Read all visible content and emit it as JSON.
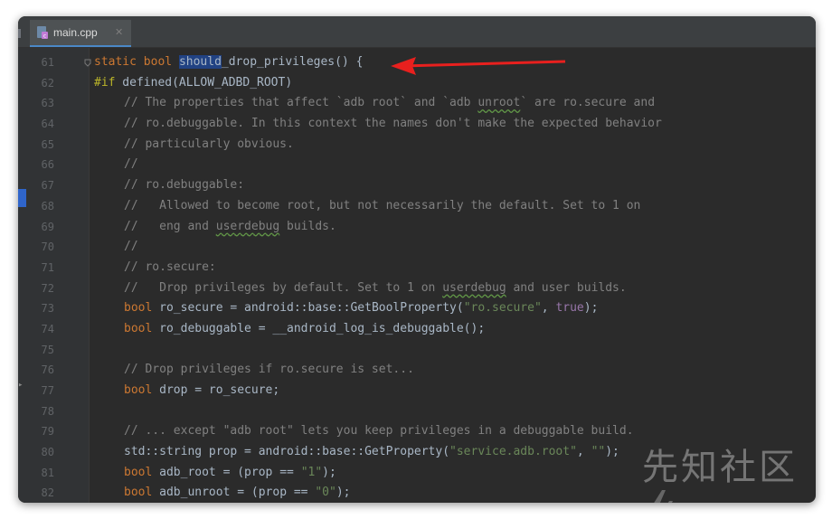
{
  "editor": {
    "tab": {
      "label": "main.cpp",
      "close": "✕",
      "icon": "cpp-file-icon"
    },
    "accent": "#4a88c7"
  },
  "watermark": "先知社区",
  "lines": [
    {
      "num": "61",
      "parts": [
        {
          "c": "kw",
          "t": "static"
        },
        {
          "c": "",
          "t": " "
        },
        {
          "c": "kw",
          "t": "bool"
        },
        {
          "c": "",
          "t": " "
        },
        {
          "c": "hl",
          "t": "should"
        },
        {
          "c": "",
          "t": "_drop_privileges() {"
        }
      ]
    },
    {
      "num": "62",
      "parts": [
        {
          "c": "pp",
          "t": "#if"
        },
        {
          "c": "",
          "t": " defined(ALLOW_ADBD_ROOT)"
        }
      ]
    },
    {
      "num": "63",
      "parts": [
        {
          "c": "cm",
          "t": "// The properties that affect `adb root` and `adb "
        },
        {
          "c": "cm sq",
          "t": "unroot"
        },
        {
          "c": "cm",
          "t": "` are ro.secure and"
        }
      ]
    },
    {
      "num": "64",
      "parts": [
        {
          "c": "cm",
          "t": "// ro.debuggable. In this context the names don't make the expected behavior"
        }
      ]
    },
    {
      "num": "65",
      "parts": [
        {
          "c": "cm",
          "t": "// particularly obvious."
        }
      ]
    },
    {
      "num": "66",
      "parts": [
        {
          "c": "cm",
          "t": "//"
        }
      ]
    },
    {
      "num": "67",
      "parts": [
        {
          "c": "cm",
          "t": "// ro.debuggable:"
        }
      ]
    },
    {
      "num": "68",
      "parts": [
        {
          "c": "cm",
          "t": "//   Allowed to become root, but not necessarily the default. Set to 1 on"
        }
      ]
    },
    {
      "num": "69",
      "parts": [
        {
          "c": "cm",
          "t": "//   eng and "
        },
        {
          "c": "cm sq",
          "t": "userdebug"
        },
        {
          "c": "cm",
          "t": " builds."
        }
      ]
    },
    {
      "num": "70",
      "parts": [
        {
          "c": "cm",
          "t": "//"
        }
      ]
    },
    {
      "num": "71",
      "parts": [
        {
          "c": "cm",
          "t": "// ro.secure:"
        }
      ]
    },
    {
      "num": "72",
      "parts": [
        {
          "c": "cm",
          "t": "//   Drop privileges by default. Set to 1 on "
        },
        {
          "c": "cm sq",
          "t": "userdebug"
        },
        {
          "c": "cm",
          "t": " and user builds."
        }
      ]
    },
    {
      "num": "73",
      "parts": [
        {
          "c": "kw",
          "t": "bool"
        },
        {
          "c": "",
          "t": " ro_secure = android::base::GetBoolProperty("
        },
        {
          "c": "st",
          "t": "\"ro.secure\""
        },
        {
          "c": "",
          "t": ", "
        },
        {
          "c": "pu",
          "t": "true"
        },
        {
          "c": "",
          "t": ");"
        }
      ]
    },
    {
      "num": "74",
      "parts": [
        {
          "c": "kw",
          "t": "bool"
        },
        {
          "c": "",
          "t": " ro_debuggable = __android_log_is_debuggable();"
        }
      ]
    },
    {
      "num": "75",
      "parts": []
    },
    {
      "num": "76",
      "parts": [
        {
          "c": "cm",
          "t": "// Drop privileges if ro.secure is set..."
        }
      ]
    },
    {
      "num": "77",
      "parts": [
        {
          "c": "kw",
          "t": "bool"
        },
        {
          "c": "",
          "t": " drop = ro_secure;"
        }
      ]
    },
    {
      "num": "78",
      "parts": []
    },
    {
      "num": "79",
      "parts": [
        {
          "c": "cm",
          "t": "// ... except \"adb root\" lets you keep privileges in a debuggable build."
        }
      ]
    },
    {
      "num": "80",
      "parts": [
        {
          "c": "",
          "t": "std::string prop = android::base::GetProperty("
        },
        {
          "c": "st",
          "t": "\"service.adb.root\""
        },
        {
          "c": "",
          "t": ", "
        },
        {
          "c": "st",
          "t": "\"\""
        },
        {
          "c": "",
          "t": ");"
        }
      ]
    },
    {
      "num": "81",
      "parts": [
        {
          "c": "kw",
          "t": "bool"
        },
        {
          "c": "",
          "t": " adb_root = (prop == "
        },
        {
          "c": "st",
          "t": "\"1\""
        },
        {
          "c": "",
          "t": ");"
        }
      ]
    },
    {
      "num": "82",
      "parts": [
        {
          "c": "kw",
          "t": "bool"
        },
        {
          "c": "",
          "t": " adb_unroot = (prop == "
        },
        {
          "c": "st",
          "t": "\"0\""
        },
        {
          "c": "",
          "t": ");"
        }
      ]
    }
  ]
}
